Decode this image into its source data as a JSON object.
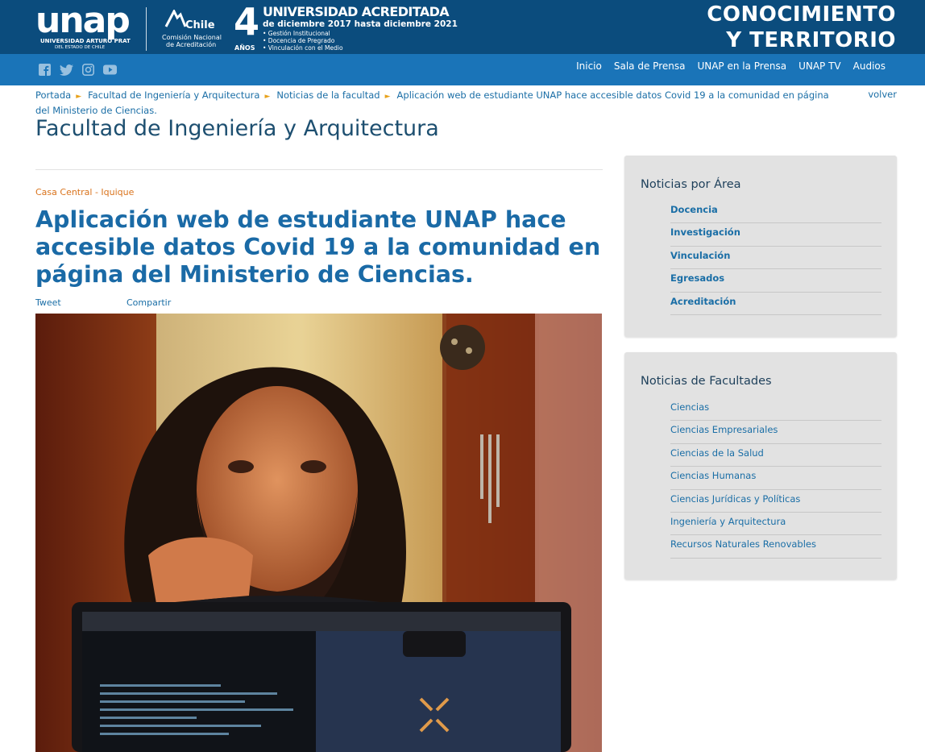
{
  "banner": {
    "logo_word": "unap",
    "logo_sub1": "UNIVERSIDAD ARTURO PRAT",
    "logo_sub2": "DEL ESTADO DE CHILE",
    "cna_name": "Chile",
    "cna_line1": "Comisión Nacional",
    "cna_line2": "de Acreditación",
    "years_number": "4",
    "years_label": "AÑOS",
    "accred_title": "UNIVERSIDAD ACREDITADA",
    "accred_period": "de diciembre 2017 hasta diciembre 2021",
    "accred_areas": [
      "• Gestión Institucional",
      "• Docencia de Pregrado",
      "• Vinculación con el Medio"
    ],
    "tagline_line1": "CONOCIMIENTO",
    "tagline_line2": "Y TERRITORIO"
  },
  "nav": {
    "socials": [
      "facebook-icon",
      "twitter-icon",
      "instagram-icon",
      "youtube-icon"
    ],
    "links": [
      "Inicio",
      "Sala de Prensa",
      "UNAP en la Prensa",
      "UNAP TV",
      "Audios"
    ]
  },
  "breadcrumb": {
    "items": [
      "Portada",
      "Facultad de Ingeniería y Arquitectura",
      "Noticias de la facultad",
      "Aplicación web de estudiante UNAP hace accesible datos Covid 19 a la comunidad en página del Ministerio de Ciencias."
    ],
    "back_label": "volver"
  },
  "page": {
    "faculty_title": "Facultad de Ingeniería y Arquitectura"
  },
  "article": {
    "location": "Casa Central - Iquique",
    "headline": "Aplicación web de estudiante UNAP hace accesible datos Covid 19 a la comunidad en página del Ministerio de Ciencias.",
    "tweet_label": "Tweet",
    "share_label": "Compartir"
  },
  "sidebar": {
    "areas_title": "Noticias por Área",
    "areas": [
      "Docencia",
      "Investigación",
      "Vinculación",
      "Egresados",
      "Acreditación"
    ],
    "faculties_title": "Noticias de Facultades",
    "faculties": [
      "Ciencias",
      "Ciencias Empresariales",
      "Ciencias de la Salud",
      "Ciencias Humanas",
      "Ciencias Jurídicas y Políticas",
      "Ingeniería y Arquitectura",
      "Recursos Naturales Renovables"
    ]
  },
  "colors": {
    "banner": "#0b4c7d",
    "navbar": "#1a74b8",
    "link": "#1a6ea6",
    "headline": "#1a6aa6",
    "accent_orange": "#d9731c",
    "sidebar_bg": "#e2e2e2"
  }
}
